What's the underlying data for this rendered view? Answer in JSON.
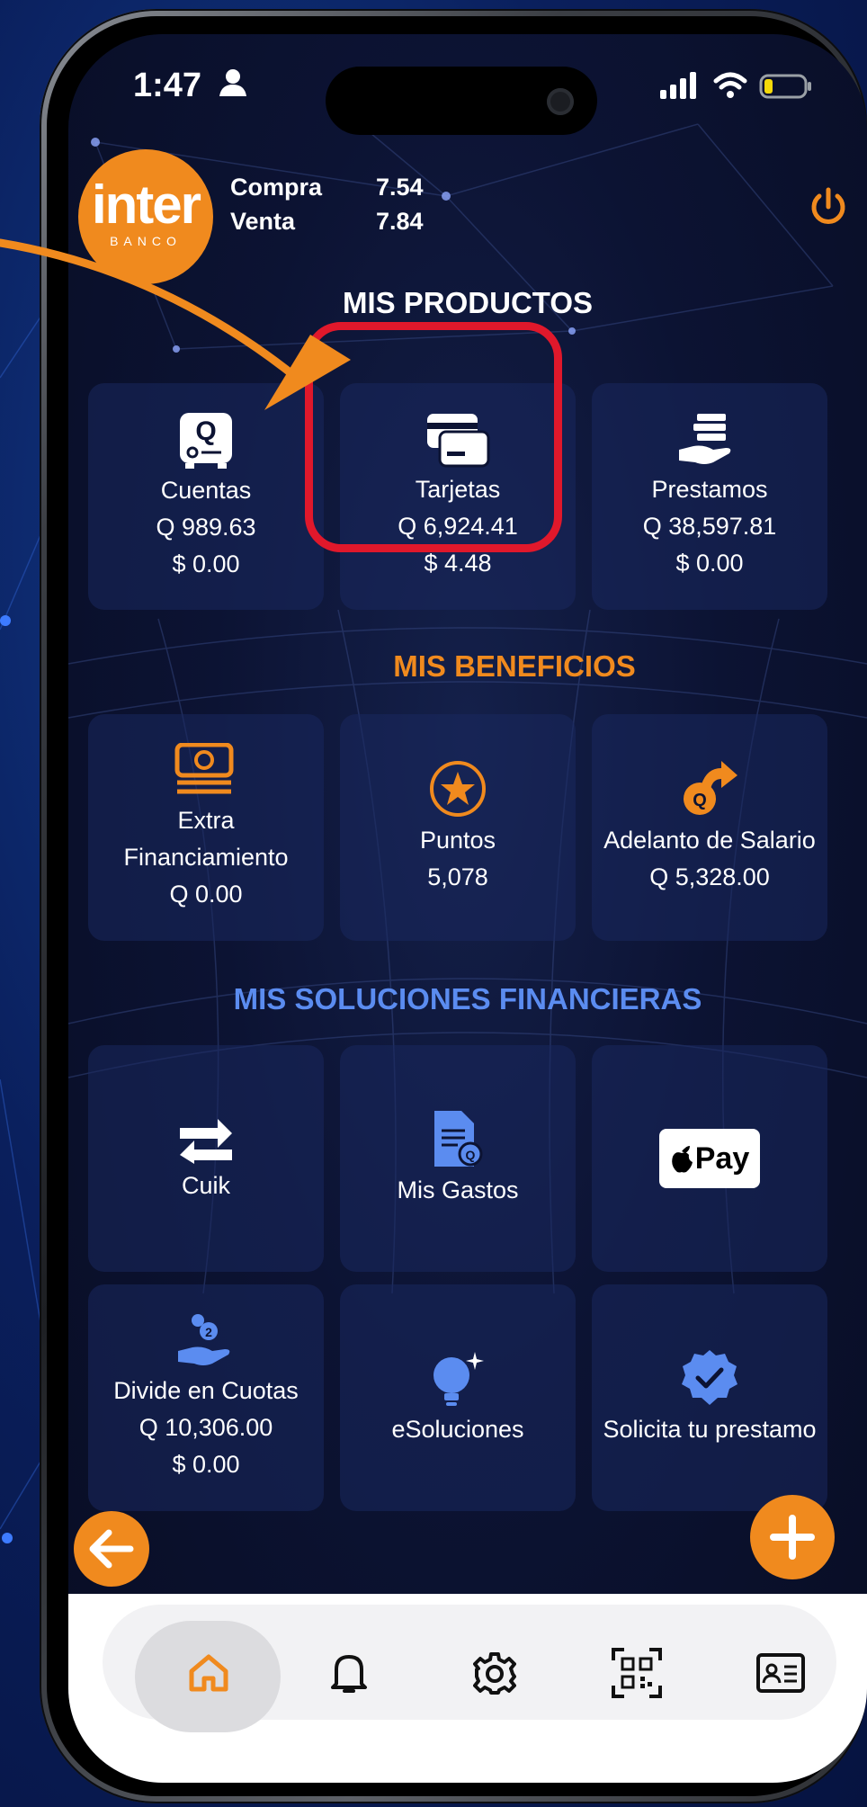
{
  "status_bar": {
    "time": "1:47"
  },
  "logo": {
    "main": "inter",
    "sub": "BANCO"
  },
  "exchange": {
    "buy_label": "Compra",
    "buy_value": "7.54",
    "sell_label": "Venta",
    "sell_value": "7.84"
  },
  "products": {
    "title": "MIS PRODUCTOS",
    "items": [
      {
        "label": "Cuentas",
        "gtq": "Q 989.63",
        "usd": "$ 0.00",
        "icon": "safe-icon"
      },
      {
        "label": "Tarjetas",
        "gtq": "Q 6,924.41",
        "usd": "$ 4.48",
        "icon": "cards-icon"
      },
      {
        "label": "Prestamos",
        "gtq": "Q 38,597.81",
        "usd": "$ 0.00",
        "icon": "loan-hand-icon"
      }
    ]
  },
  "benefits": {
    "title": "MIS BENEFICIOS",
    "items": [
      {
        "label1": "Extra",
        "label2": "Financiamiento",
        "value": "Q 0.00",
        "icon": "money-stack-icon"
      },
      {
        "label": "Puntos",
        "value": "5,078",
        "icon": "star-circle-icon"
      },
      {
        "label": "Adelanto de Salario",
        "value": "Q 5,328.00",
        "icon": "coin-arrow-icon"
      }
    ]
  },
  "solutions": {
    "title": "MIS SOLUCIONES FINANCIERAS",
    "items": [
      {
        "label": "Cuik",
        "icon": "transfer-arrows-icon"
      },
      {
        "label": "Mis Gastos",
        "icon": "document-icon"
      },
      {
        "label": "Pay",
        "icon": "apple-pay-icon"
      },
      {
        "label": "Divide en Cuotas",
        "gtq": "Q 10,306.00",
        "usd": "$ 0.00",
        "icon": "coins-hand-icon"
      },
      {
        "label": "eSoluciones",
        "icon": "lightbulb-icon"
      },
      {
        "label": "Solicita tu prestamo",
        "icon": "verified-badge-icon"
      }
    ]
  },
  "colors": {
    "accent": "#f08a1e",
    "highlight": "#e0182b",
    "title_blue": "#5b8cf0"
  },
  "tabbar": [
    "home-icon",
    "bell-icon",
    "gear-icon",
    "qr-code-icon",
    "id-card-icon"
  ]
}
